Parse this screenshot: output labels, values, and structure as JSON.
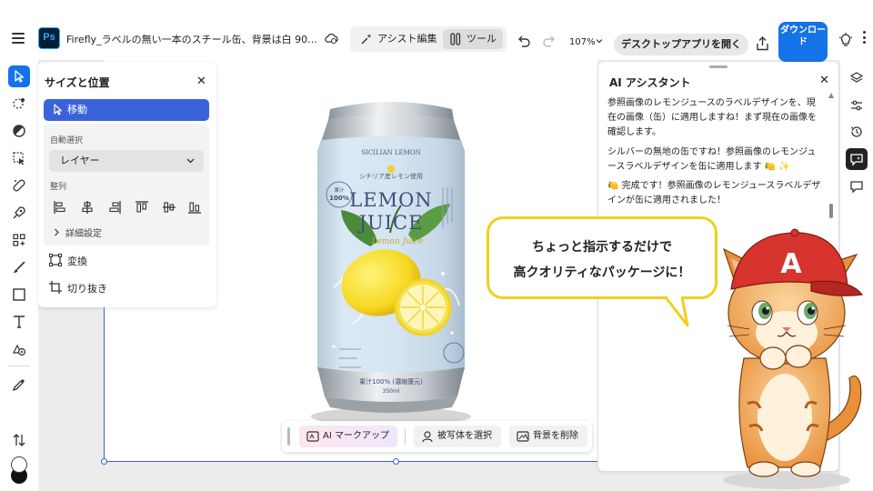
{
  "header": {
    "doc_title": "Firefly_ラベルの無い一本のスチール缶、背景は白 90…",
    "mode_assist": "アシスト編集",
    "mode_tool": "ツール",
    "zoom": "107%",
    "open_desktop": "デスクトップアプリを開く",
    "download_label": "ダウンロード"
  },
  "sp_panel": {
    "title": "サイズと位置",
    "close": "✕",
    "move": "移動",
    "auto_select_label": "自動選択",
    "auto_select_value": "レイヤー",
    "align_label": "整列",
    "advanced": "詳細設定",
    "transform": "変換",
    "crop": "切り抜き"
  },
  "canvas_tools": {
    "markup": "AI マークアップ",
    "select_subject": "被写体を選択",
    "remove_bg": "背景を削除"
  },
  "can_label": {
    "top_arc": "SICILIAN LEMON",
    "origin": "シチリア産レモン使用",
    "badge_line1": "果汁",
    "badge_line2": "100%",
    "brand1": "LEMON",
    "brand2": "JUICE",
    "script": "Lemon Juice",
    "bottom1": "果汁100% (濃縮還元)",
    "bottom2": "350ml"
  },
  "ai_panel": {
    "title": "AI アシスタント",
    "close": "✕",
    "messages": [
      "参照画像のレモンジュースのラベルデザインを、現在の画像（缶）に適用しますね！まず現在の画像を確認します。",
      "シルバーの無地の缶ですね！参照画像のレモンジュースラベルデザインを缶に適用します 🍋 ✨",
      "🍋 完成です！参照画像のレモンジュースラベルデザインが缶に適用されました！"
    ]
  },
  "bubble": {
    "line1": "ちょっと指示するだけで",
    "line2": "高クオリティなパッケージに！"
  },
  "cat": {
    "cap_letter": "A"
  },
  "colors": {
    "accent": "#1473e6",
    "move_button": "#3a63db",
    "bubble_border": "#f2cf1c",
    "can_body": "#d6e6f2",
    "brand_text": "#3c4f7a"
  },
  "icons": {
    "left_toolbar": [
      "move-tool-icon",
      "quick-select-icon",
      "adjust-icon",
      "object-select-icon",
      "heal-brush-icon",
      "generative-icon",
      "grid-icon",
      "brush-icon",
      "rectangle-icon",
      "type-icon",
      "add-shape-icon",
      "eyedropper-icon",
      "swap-colors-icon"
    ],
    "right_rail": [
      "layers-icon",
      "adjustments-icon",
      "history-icon",
      "ai-assistant-icon",
      "comment-icon"
    ]
  }
}
